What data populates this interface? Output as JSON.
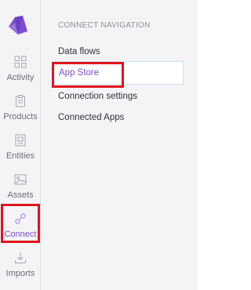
{
  "brand": {
    "logo_color": "#7a4fd0",
    "accent_color": "#7a4fd0",
    "highlight_color": "#e0151d"
  },
  "rail": {
    "items": [
      {
        "label": "Activity",
        "icon": "grid-icon"
      },
      {
        "label": "Products",
        "icon": "clipboard-icon"
      },
      {
        "label": "Entities",
        "icon": "entities-icon"
      },
      {
        "label": "Assets",
        "icon": "image-icon"
      },
      {
        "label": "Connect",
        "icon": "link-icon",
        "active": true
      },
      {
        "label": "Imports",
        "icon": "download-icon"
      }
    ]
  },
  "nav": {
    "heading": "CONNECT NAVIGATION",
    "items": [
      {
        "label": "Data flows"
      },
      {
        "label": "App Store",
        "selected": true
      },
      {
        "label": "Connection settings"
      },
      {
        "label": "Connected Apps"
      }
    ]
  }
}
